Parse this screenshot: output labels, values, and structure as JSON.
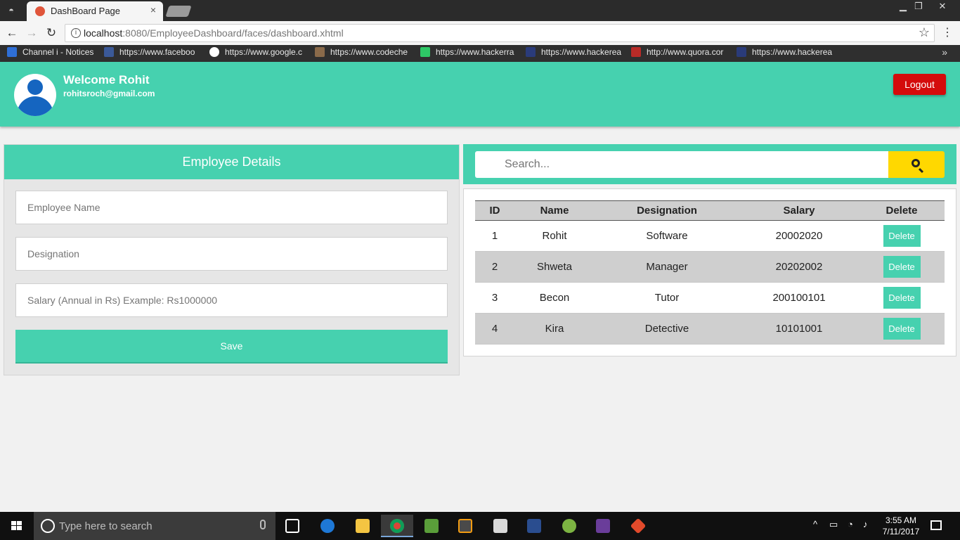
{
  "browser": {
    "tab_title": "DashBoard Page",
    "tab_close": "×",
    "url_host": "localhost",
    "url_rest": ":8080/EmployeeDashboard/faces/dashboard.xhtml",
    "bookmarks": [
      {
        "label": "Channel i - Notices",
        "icon": "bookmark-channel-icon",
        "color": "#2f6fd6"
      },
      {
        "label": "https://www.faceboo",
        "icon": "facebook-icon",
        "color": "#3b5998"
      },
      {
        "label": "https://www.google.c",
        "icon": "google-icon",
        "color": "#ffffff"
      },
      {
        "label": "https://www.codeche",
        "icon": "codechef-icon",
        "color": "#8a6a4a"
      },
      {
        "label": "https://www.hackerra",
        "icon": "hackerrank-icon",
        "color": "#2ec866"
      },
      {
        "label": "https://www.hackerea",
        "icon": "hackerearth-icon",
        "color": "#2a3b7a"
      },
      {
        "label": "http://www.quora.cor",
        "icon": "quora-icon",
        "color": "#b92b27"
      },
      {
        "label": "https://www.hackerea",
        "icon": "hackerearth-icon",
        "color": "#2a3b7a"
      }
    ],
    "bookmarks_more": "»"
  },
  "header": {
    "welcome": "Welcome Rohit",
    "email": "rohitsroch@gmail.com",
    "logout_label": "Logout",
    "accent_color": "#46d1af",
    "logout_color": "#d40b0b"
  },
  "form": {
    "title": "Employee Details",
    "name_placeholder": "Employee Name",
    "designation_placeholder": "Designation",
    "salary_placeholder": "Salary (Annual in Rs) Example: Rs1000000",
    "save_label": "Save"
  },
  "search": {
    "placeholder": "Search...",
    "button_color": "#ffd800"
  },
  "table": {
    "headers": {
      "id": "ID",
      "name": "Name",
      "designation": "Designation",
      "salary": "Salary",
      "delete": "Delete"
    },
    "delete_label": "Delete",
    "rows": [
      {
        "id": "1",
        "name": "Rohit",
        "designation": "Software",
        "salary": "20002020"
      },
      {
        "id": "2",
        "name": "Shweta",
        "designation": "Manager",
        "salary": "20202002"
      },
      {
        "id": "3",
        "name": "Becon",
        "designation": "Tutor",
        "salary": "200100101"
      },
      {
        "id": "4",
        "name": "Kira",
        "designation": "Detective",
        "salary": "10101001"
      }
    ]
  },
  "taskbar": {
    "search_placeholder": "Type here to search",
    "time": "3:55 AM",
    "date": "7/11/2017"
  }
}
